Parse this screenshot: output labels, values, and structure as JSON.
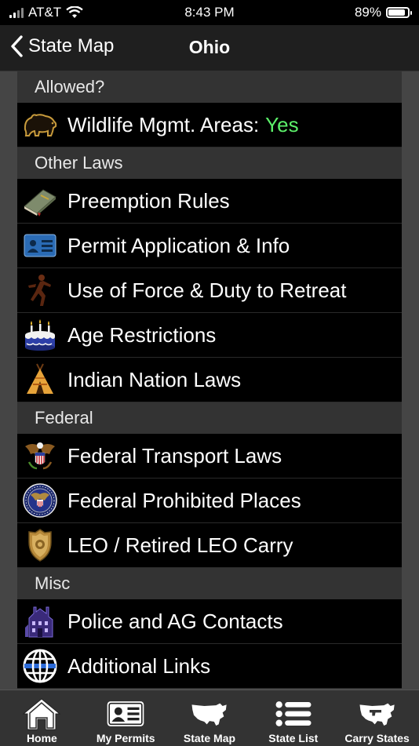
{
  "status": {
    "carrier": "AT&T",
    "time": "8:43 PM",
    "battery": "89%",
    "battery_level": 0.89
  },
  "nav": {
    "back_label": "State Map",
    "title": "Ohio"
  },
  "sections": [
    {
      "header": "Allowed?",
      "rows": [
        {
          "label": "Wildlife Mgmt. Areas:",
          "value": "Yes",
          "icon": "bear-icon"
        }
      ]
    },
    {
      "header": "Other Laws",
      "rows": [
        {
          "label": "Preemption Rules",
          "icon": "law-book-icon"
        },
        {
          "label": "Permit Application & Info",
          "icon": "id-card-icon"
        },
        {
          "label": "Use of Force & Duty to Retreat",
          "icon": "running-man-icon"
        },
        {
          "label": "Age Restrictions",
          "icon": "birthday-cake-icon"
        },
        {
          "label": "Indian Nation Laws",
          "icon": "teepee-icon"
        }
      ]
    },
    {
      "header": "Federal",
      "rows": [
        {
          "label": "Federal Transport Laws",
          "icon": "eagle-seal-icon"
        },
        {
          "label": "Federal Prohibited Places",
          "icon": "presidential-seal-icon"
        },
        {
          "label": "LEO / Retired LEO Carry",
          "icon": "police-badge-icon"
        }
      ]
    },
    {
      "header": "Misc",
      "rows": [
        {
          "label": "Police and AG Contacts",
          "icon": "police-station-icon"
        },
        {
          "label": "Additional Links",
          "icon": "globe-icon"
        }
      ]
    }
  ],
  "tabs": [
    {
      "label": "Home",
      "icon": "house-icon"
    },
    {
      "label": "My Permits",
      "icon": "permit-card-icon"
    },
    {
      "label": "State Map",
      "icon": "us-map-icon"
    },
    {
      "label": "State List",
      "icon": "list-icon"
    },
    {
      "label": "Carry States",
      "icon": "carry-states-map-icon"
    }
  ],
  "colors": {
    "accent_value": "#5cf06a",
    "section_header_bg": "#333333",
    "row_bg": "#000000",
    "tabbar_bg": "#333333"
  }
}
